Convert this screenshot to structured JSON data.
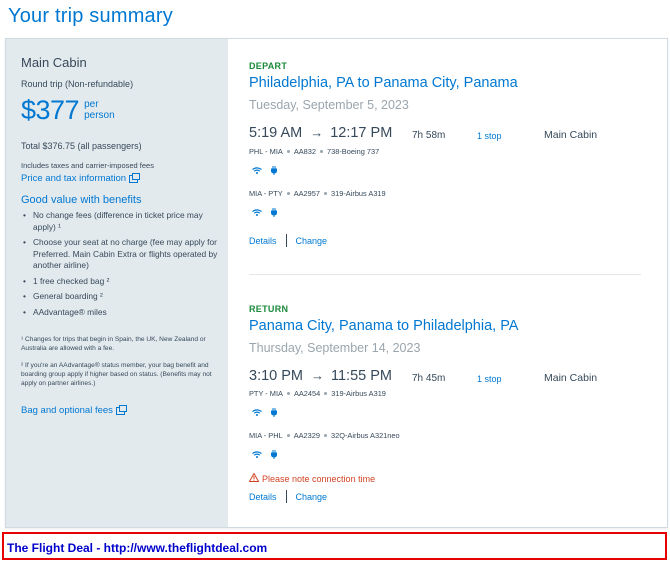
{
  "page": {
    "title": "Your trip summary"
  },
  "fare": {
    "cabin_title": "Main Cabin",
    "trip_type": "Round trip (Non-refundable)",
    "price": "$377",
    "per_line1": "per",
    "per_line2": "person",
    "total": "Total $376.75 (all passengers)",
    "includes": "Includes taxes and carrier-imposed fees",
    "price_info_link": "Price and tax information",
    "benefits_title": "Good value with benefits",
    "benefits": [
      "No change fees (difference in ticket price may apply) ¹",
      "Choose your seat at no charge (fee may apply for Preferred. Main Cabin Extra or flights operated by another airline)",
      "1 free checked bag ²",
      "General boarding ²",
      "AAdvantage® miles"
    ],
    "footnote1": "¹ Changes for trips that begin in Spain, the UK, New Zealand or Australia are allowed with a fee.",
    "footnote2": "² If you're an AAdvantage® status member, your bag benefit and boarding group apply if higher based on status. (Benefits may not apply on partner airlines.)",
    "bag_fees_link": "Bag and optional fees"
  },
  "depart": {
    "label": "DEPART",
    "route": "Philadelphia, PA to Panama City, Panama",
    "date": "Tuesday, September 5, 2023",
    "dep_time": "5:19 AM",
    "arrow": "→",
    "arr_time": "12:17 PM",
    "duration": "7h 58m",
    "stops": "1 stop",
    "cabin": "Main Cabin",
    "seg1": {
      "route": "PHL - MIA",
      "flight": "AA832",
      "aircraft": "738-Boeing 737"
    },
    "seg2": {
      "route": "MIA - PTY",
      "flight": "AA2957",
      "aircraft": "319-Airbus A319"
    },
    "details": "Details",
    "change": "Change"
  },
  "return": {
    "label": "RETURN",
    "route": "Panama City, Panama to Philadelphia, PA",
    "date": "Thursday, September 14, 2023",
    "dep_time": "3:10 PM",
    "arrow": "→",
    "arr_time": "11:55 PM",
    "duration": "7h 45m",
    "stops": "1 stop",
    "cabin": "Main Cabin",
    "seg1": {
      "route": "PTY - MIA",
      "flight": "AA2454",
      "aircraft": "319-Airbus A319"
    },
    "seg2": {
      "route": "MIA - PHL",
      "flight": "AA2329",
      "aircraft": "32Q-Airbus A321neo"
    },
    "warning": "Please note connection time",
    "details": "Details",
    "change": "Change"
  },
  "footer": {
    "text": "The Flight Deal - http://www.theflightdeal.com"
  },
  "colors": {
    "accent": "#0078d2",
    "depart_green": "#1a8a3a",
    "warning": "#d14424",
    "panel_bg": "#e3eaee",
    "footer_border": "#e60000",
    "footer_text": "#0000cc"
  },
  "icons": {
    "wifi": "wifi-icon",
    "power": "power-icon",
    "external": "external-link-icon",
    "warning": "warning-icon"
  }
}
